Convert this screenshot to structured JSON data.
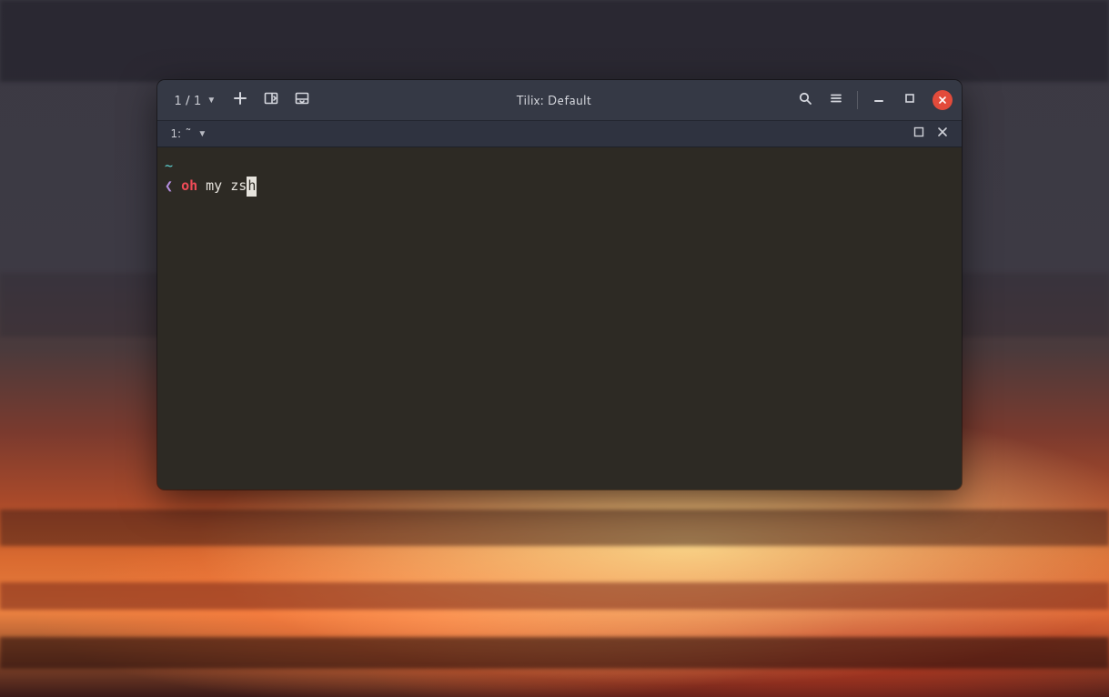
{
  "window": {
    "title": "Tilix: Default"
  },
  "titlebar": {
    "session_counter": "1 / 1"
  },
  "tabbar": {
    "tab_label": "1: ~"
  },
  "terminal": {
    "cwd_indicator": "~",
    "prompt_glyph": "❮",
    "cmd_word1": "oh",
    "cmd_word2": "my",
    "cmd_word3_head": "zs",
    "cmd_word3_cursor": "h"
  },
  "colors": {
    "titlebar_bg": "#353945",
    "tabbar_bg": "#2f3340",
    "terminal_bg": "#2d2a24",
    "close_btn": "#e24b3b",
    "prompt_cyan": "#5fd7d7",
    "prompt_purple": "#b48ee0",
    "cmd_red": "#ef4b57"
  },
  "icons": {
    "session_dropdown": "chevron-down-icon",
    "new_session": "plus-icon",
    "split_right": "split-right-icon",
    "split_down": "split-down-icon",
    "search": "search-icon",
    "menu": "hamburger-icon",
    "minimize": "minimize-icon",
    "maximize": "maximize-icon",
    "close": "close-icon",
    "tab_dropdown": "chevron-down-icon",
    "tab_maximize": "pane-maximize-icon",
    "tab_close": "close-icon"
  }
}
